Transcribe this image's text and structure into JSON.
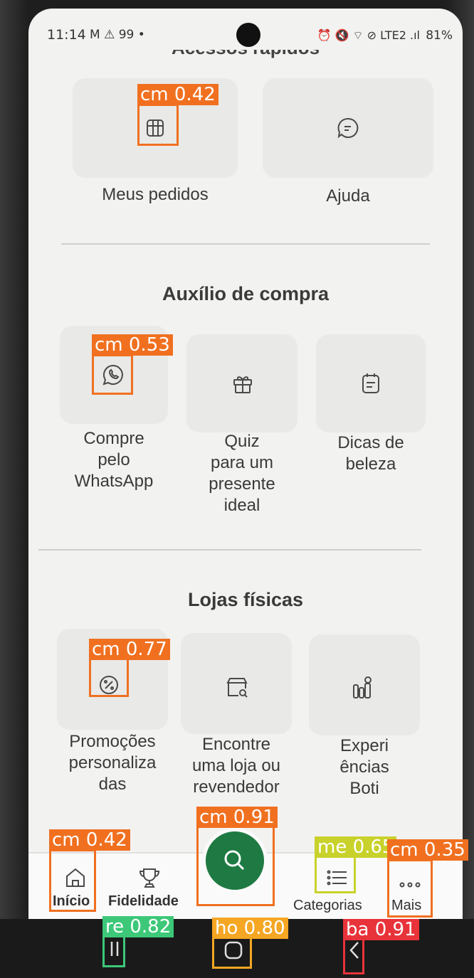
{
  "status_bar": {
    "time": "11:14",
    "left_icons": "M ⚠ 99 •",
    "right_icons": "⏰ 🔇 ⌔ ⊘ LTE2 .ıl",
    "battery": "81%"
  },
  "partial_section_title": "Acessos rápidos",
  "quick_access": {
    "items": [
      {
        "label": "Meus pedidos",
        "icon": "orders-grid-icon"
      },
      {
        "label": "Ajuda",
        "icon": "chat-bubble-icon"
      }
    ]
  },
  "purchase_help": {
    "title": "Auxílio de compra",
    "items": [
      {
        "label_lines": [
          "Compre",
          "pelo",
          "WhatsApp"
        ],
        "icon": "whatsapp-icon"
      },
      {
        "label_lines": [
          "Quiz",
          "para um",
          "presente",
          "ideal"
        ],
        "icon": "gift-icon"
      },
      {
        "label_lines": [
          "Dicas de",
          "beleza"
        ],
        "icon": "notepad-icon"
      }
    ]
  },
  "physical_stores": {
    "title": "Lojas físicas",
    "items": [
      {
        "label_lines": [
          "Promoções",
          "personaliza",
          "das"
        ],
        "icon": "discount-badge-icon"
      },
      {
        "label_lines": [
          "Encontre",
          "uma loja ou",
          "revendedor"
        ],
        "icon": "store-search-icon"
      },
      {
        "label_lines": [
          "Experi",
          "ências",
          "Boti"
        ],
        "icon": "cosmetics-icon"
      }
    ]
  },
  "bottom_nav": {
    "items": [
      {
        "label": "Início",
        "icon": "home-icon"
      },
      {
        "label": "Fidelidade",
        "icon": "trophy-icon"
      },
      {
        "label": "",
        "icon": "search-icon"
      },
      {
        "label": "Categorias",
        "icon": "list-icon"
      },
      {
        "label": "Mais",
        "icon": "more-dots-icon"
      }
    ]
  },
  "detections": [
    {
      "tag": "cm 0.42",
      "color": "#f07020"
    },
    {
      "tag": "cm 0.53",
      "color": "#f07020"
    },
    {
      "tag": "cm 0.77",
      "color": "#f07020"
    },
    {
      "tag": "cm 0.91",
      "color": "#f07020"
    },
    {
      "tag": "cm 0.42",
      "color": "#f07020"
    },
    {
      "tag": "me 0.65",
      "color": "#c8d22a"
    },
    {
      "tag": "cm 0.35",
      "color": "#f07020"
    },
    {
      "tag": "re 0.82",
      "color": "#3cc878"
    },
    {
      "tag": "ho 0.80",
      "color": "#f5a623"
    },
    {
      "tag": "ba 0.91",
      "color": "#e8333a"
    }
  ],
  "colors": {
    "accent_green": "#1e7a42",
    "screen_bg": "#f2f2f0",
    "card_bg": "#e9e9e7"
  }
}
